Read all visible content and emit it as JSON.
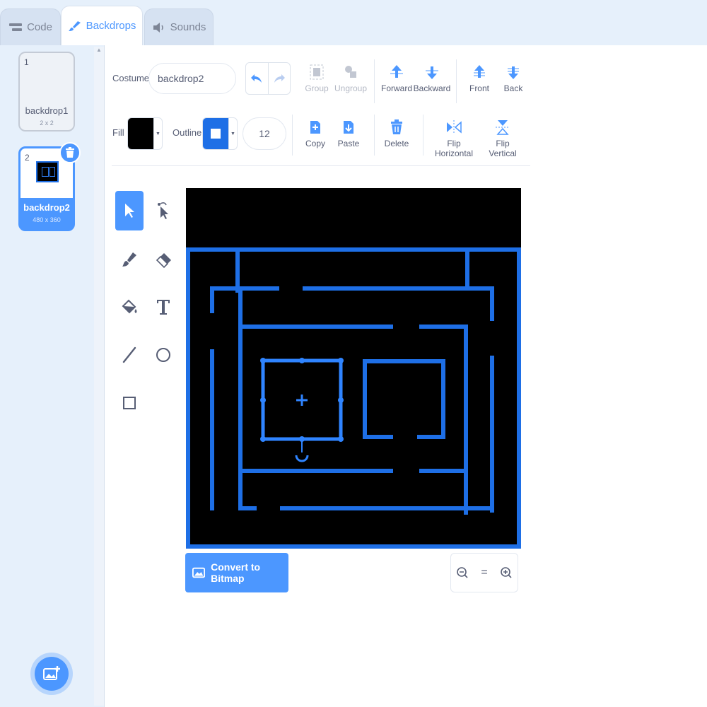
{
  "tabs": [
    {
      "label": "Code",
      "icon": "code-icon"
    },
    {
      "label": "Backdrops",
      "icon": "paintbrush-icon"
    },
    {
      "label": "Sounds",
      "icon": "speaker-icon"
    }
  ],
  "backdrops": [
    {
      "number": "1",
      "name": "backdrop1",
      "size": "2 x 2"
    },
    {
      "number": "2",
      "name": "backdrop2",
      "size": "480 x 360"
    }
  ],
  "editor": {
    "costume_label": "Costume",
    "costume_name": "backdrop2",
    "fill_label": "Fill",
    "outline_label": "Outline",
    "outline_width": "12",
    "fill_color": "#000000",
    "outline_color": "#1e6fe6",
    "toolbar": {
      "group": "Group",
      "ungroup": "Ungroup",
      "forward": "Forward",
      "backward": "Backward",
      "front": "Front",
      "back": "Back",
      "copy": "Copy",
      "paste": "Paste",
      "delete": "Delete",
      "flip_horizontal": "Flip Horizontal",
      "flip_vertical": "Flip Vertical"
    },
    "convert_label": "Convert to Bitmap",
    "zoom": {
      "out": "−",
      "reset": "=",
      "in": "+"
    }
  },
  "colors": {
    "accent": "#4c97ff",
    "maze_blue": "#1e6fe6",
    "canvas_bg": "#000000"
  }
}
